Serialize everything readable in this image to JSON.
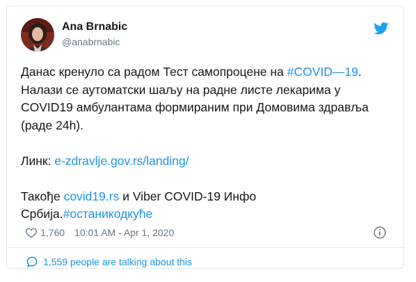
{
  "tweet": {
    "author": {
      "display_name": "Ana Brnabic",
      "handle": "@anabrnabic"
    },
    "text": {
      "line1_prefix": "Данас кренуло са радом Тест самопроцене на ",
      "line1_hashtag": "#COVID—19",
      "line1_suffix": ".",
      "line2": "Налази се аутоматски шаљу на радне листе лекарима у",
      "line3": "COVID19 амбулантама формираним при Домовима здравља",
      "line4": "(раде 24h).",
      "link_prefix": "Линк: ",
      "link_url": "e-zdravlje.gov.rs/landing/",
      "also_prefix": "Такође ",
      "also_link": "covid19.rs",
      "also_suffix": " и Viber COVID-19 Инфо",
      "last_prefix": "Србија.",
      "last_hashtag": "#останикодкуће"
    },
    "likes": "1,760",
    "timestamp": "10:01 AM - Apr 1, 2020",
    "talking": "1,559 people are talking about this",
    "icons": {
      "like": "heart-icon",
      "info": "info-icon",
      "brand": "twitter-bird-icon",
      "talking": "speech-bubble-icon"
    },
    "colors": {
      "link": "#1b95e0",
      "muted": "#657786",
      "border": "#e1e8ed",
      "text": "#14171a"
    }
  }
}
